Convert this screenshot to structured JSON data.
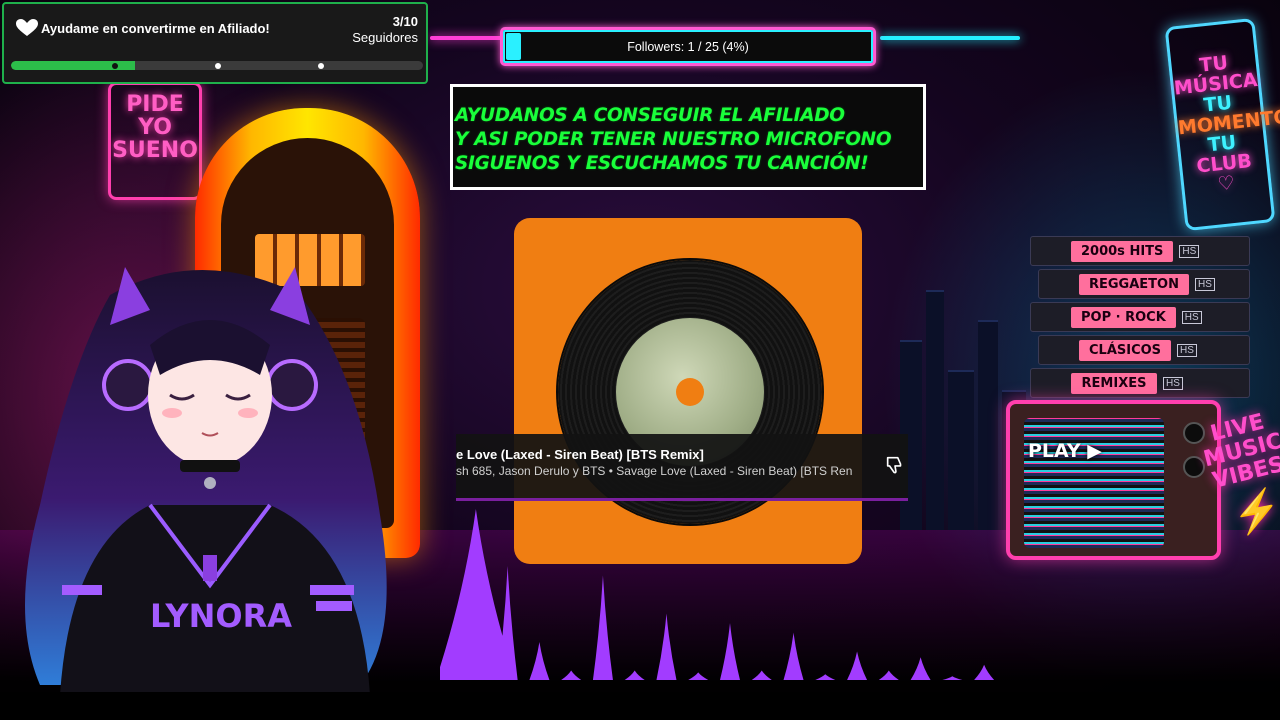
{
  "goal_widget": {
    "icon": "heart-hands-icon",
    "title": "Ayudame en convertirme en Afiliado!",
    "count": "3/10",
    "count_label": "Seguidores",
    "progress_fraction": 0.3,
    "accent_color": "#2cbd4a"
  },
  "followers_bar": {
    "text": "Followers: 1 / 25 (4%)",
    "progress_fraction": 0.04,
    "border_color": "#ff5ad2",
    "fill_color": "#2af0ff"
  },
  "message": {
    "lines": [
      "AYUDANOS A CONSEGUIR EL AFILIADO",
      " Y ASI PODER TENER NUESTRO MICROFONO",
      "SIGUENOS Y ESCUCHAMOS TU CANCIÓN!"
    ],
    "color": "#19ff3a"
  },
  "now_playing": {
    "title": "e Love (Laxed - Siren Beat) [BTS Remix]",
    "subtitle": "sh 685, Jason Derulo y BTS • Savage Love (Laxed - Siren Beat) [BTS Ren",
    "dislike_icon": "thumbs-down-icon",
    "album_color": "#f07e12"
  },
  "scene": {
    "sign_left": [
      "PIDE",
      "YO",
      "SUENO"
    ],
    "sign_right": [
      {
        "text": "TU",
        "color": "#ff4ecb"
      },
      {
        "text": "MÚSICA",
        "color": "#ff4ecb"
      },
      {
        "text": "TU",
        "color": "#3df2ff"
      },
      {
        "text": "MOMENTO",
        "color": "#ff7a2e"
      },
      {
        "text": "TU",
        "color": "#3df2ff"
      },
      {
        "text": "CLUB",
        "color": "#ff4ecb"
      },
      {
        "text": "♡",
        "color": "#ff4ecb"
      }
    ],
    "tapes": [
      "2000s HITS",
      "REGGAETON",
      "POP · ROCK",
      "CLÁSICOS",
      "REMIXES"
    ],
    "tape_badge": "HS",
    "tv_label": "PLAY ▶",
    "live_sign": [
      "LIVE",
      "MUSIC",
      "VIBES"
    ],
    "avatar_shirt": "LYNORA"
  },
  "visualizer": {
    "color": "#a23cff",
    "levels": [
      0.9,
      0.6,
      0.2,
      0.05,
      0.55,
      0.05,
      0.35,
      0.04,
      0.3,
      0.05,
      0.25,
      0.03,
      0.15,
      0.05,
      0.12,
      0.02,
      0.08
    ]
  }
}
